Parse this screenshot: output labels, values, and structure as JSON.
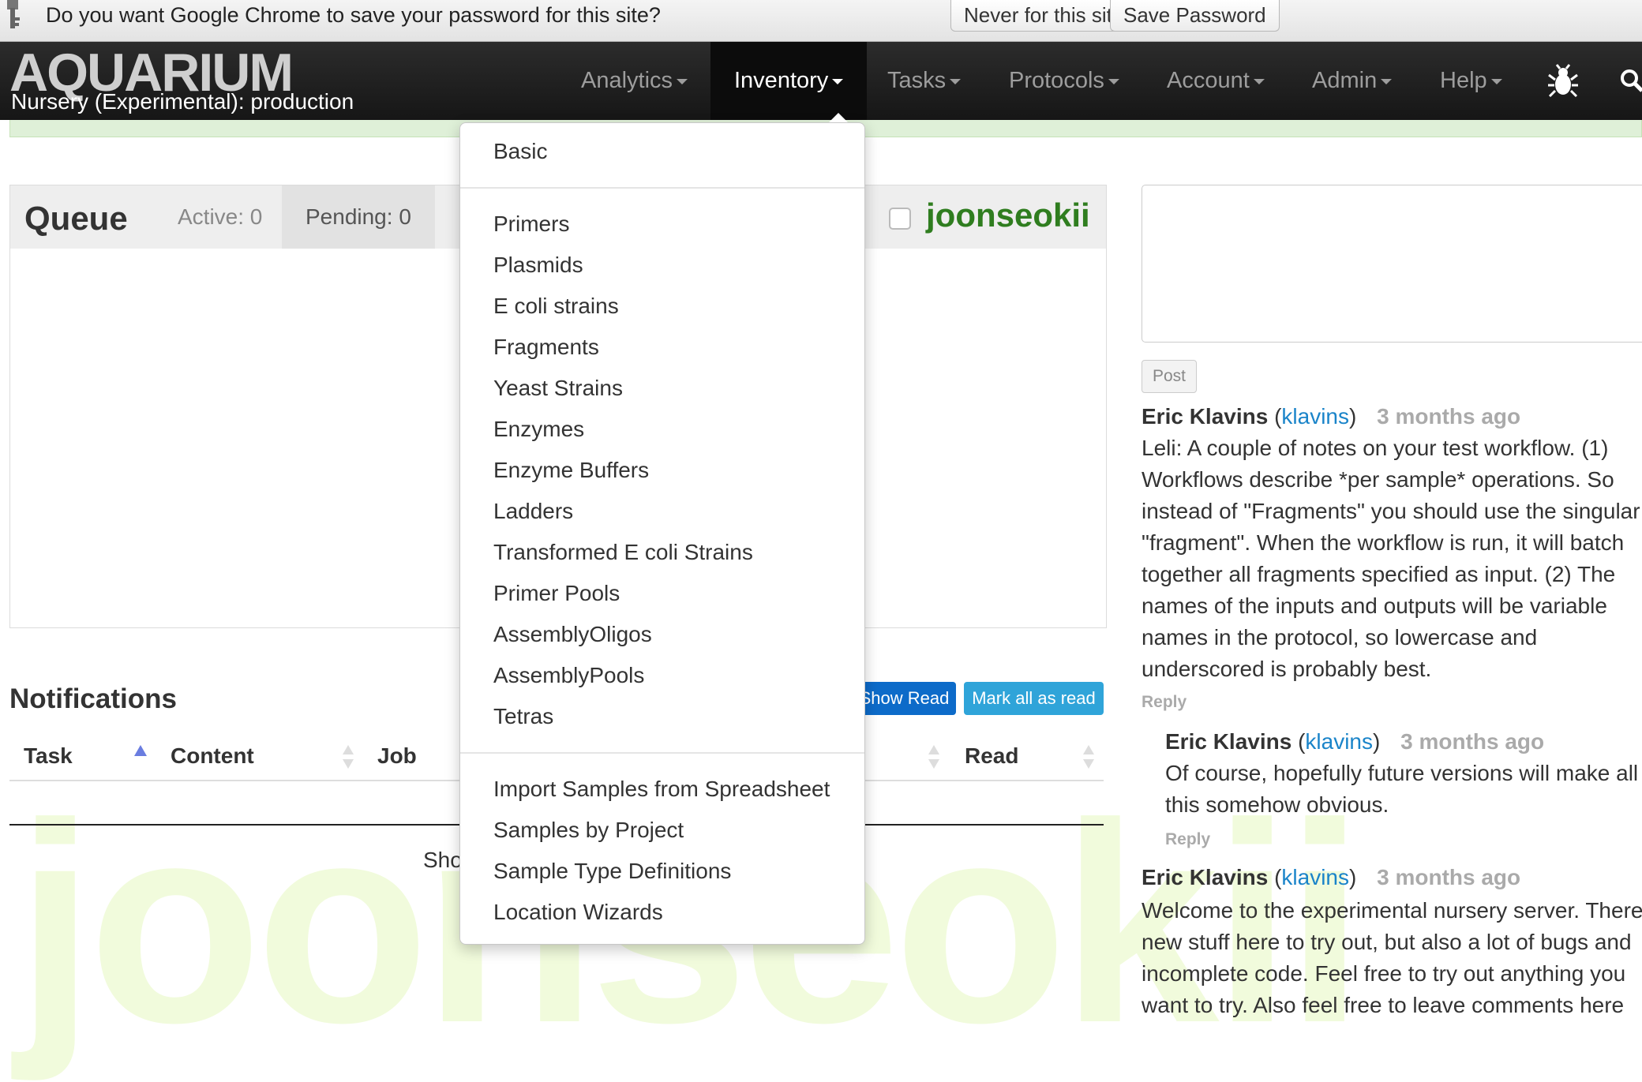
{
  "chrome_prompt": {
    "message": "Do you want Google Chrome to save your password for this site?",
    "never_button": "Never for this site",
    "save_button": "Save Password"
  },
  "brand": {
    "logo": "AQUARIUM",
    "subtitle": "Nursery (Experimental): production"
  },
  "nav": {
    "items": [
      {
        "label": "Analytics"
      },
      {
        "label": "Inventory"
      },
      {
        "label": "Tasks"
      },
      {
        "label": "Protocols"
      },
      {
        "label": "Account"
      },
      {
        "label": "Admin"
      },
      {
        "label": "Help"
      }
    ],
    "active": "Inventory",
    "icons": [
      "bug-icon",
      "search-icon"
    ]
  },
  "inventory_menu": {
    "group1": [
      "Basic"
    ],
    "group2": [
      "Primers",
      "Plasmids",
      "E coli strains",
      "Fragments",
      "Yeast Strains",
      "Enzymes",
      "Enzyme Buffers",
      "Ladders",
      "Transformed E coli Strains",
      "Primer Pools",
      "AssemblyOligos",
      "AssemblyPools",
      "Tetras"
    ],
    "group3": [
      "Import Samples from Spreadsheet",
      "Samples by Project",
      "Sample Type Definitions",
      "Location Wizards"
    ]
  },
  "queue": {
    "title": "Queue",
    "tabs": [
      "Active: 0",
      "Pending: 0"
    ],
    "user": "joonseokii"
  },
  "notifications": {
    "title": "Notifications",
    "show_read_button": "Show Read",
    "mark_all_button": "Mark all as read",
    "columns": [
      "Task",
      "Content",
      "Job",
      "Read"
    ],
    "footer_partial": "Sho",
    "watermark": "joonseokii"
  },
  "comments": {
    "post_button": "Post",
    "items": [
      {
        "author": "Eric Klavins",
        "username": "klavins",
        "time": "3 months ago",
        "lines": [
          "Leli: A couple of notes on your test workflow. (1)",
          "Workflows describe *per sample* operations. So",
          "instead of \"Fragments\" you should use the singular",
          "\"fragment\". When the workflow is run, it will batch",
          "together all fragments specified as input. (2) The",
          "names of the inputs and outputs will be variable",
          "names in the protocol, so lowercase and",
          "underscored is probably best."
        ],
        "reply": "Reply"
      },
      {
        "author": "Eric Klavins",
        "username": "klavins",
        "time": "3 months ago",
        "lines": [
          "Of course, hopefully future versions will make all",
          "this somehow obvious."
        ],
        "reply": "Reply"
      },
      {
        "author": "Eric Klavins",
        "username": "klavins",
        "time": "3 months ago",
        "lines": [
          "Welcome to the experimental nursery server. There",
          "new stuff here to try out, but also a lot of bugs and",
          "incomplete code. Feel free to try out anything you",
          "want to try. Also feel free to leave comments here"
        ]
      }
    ]
  }
}
